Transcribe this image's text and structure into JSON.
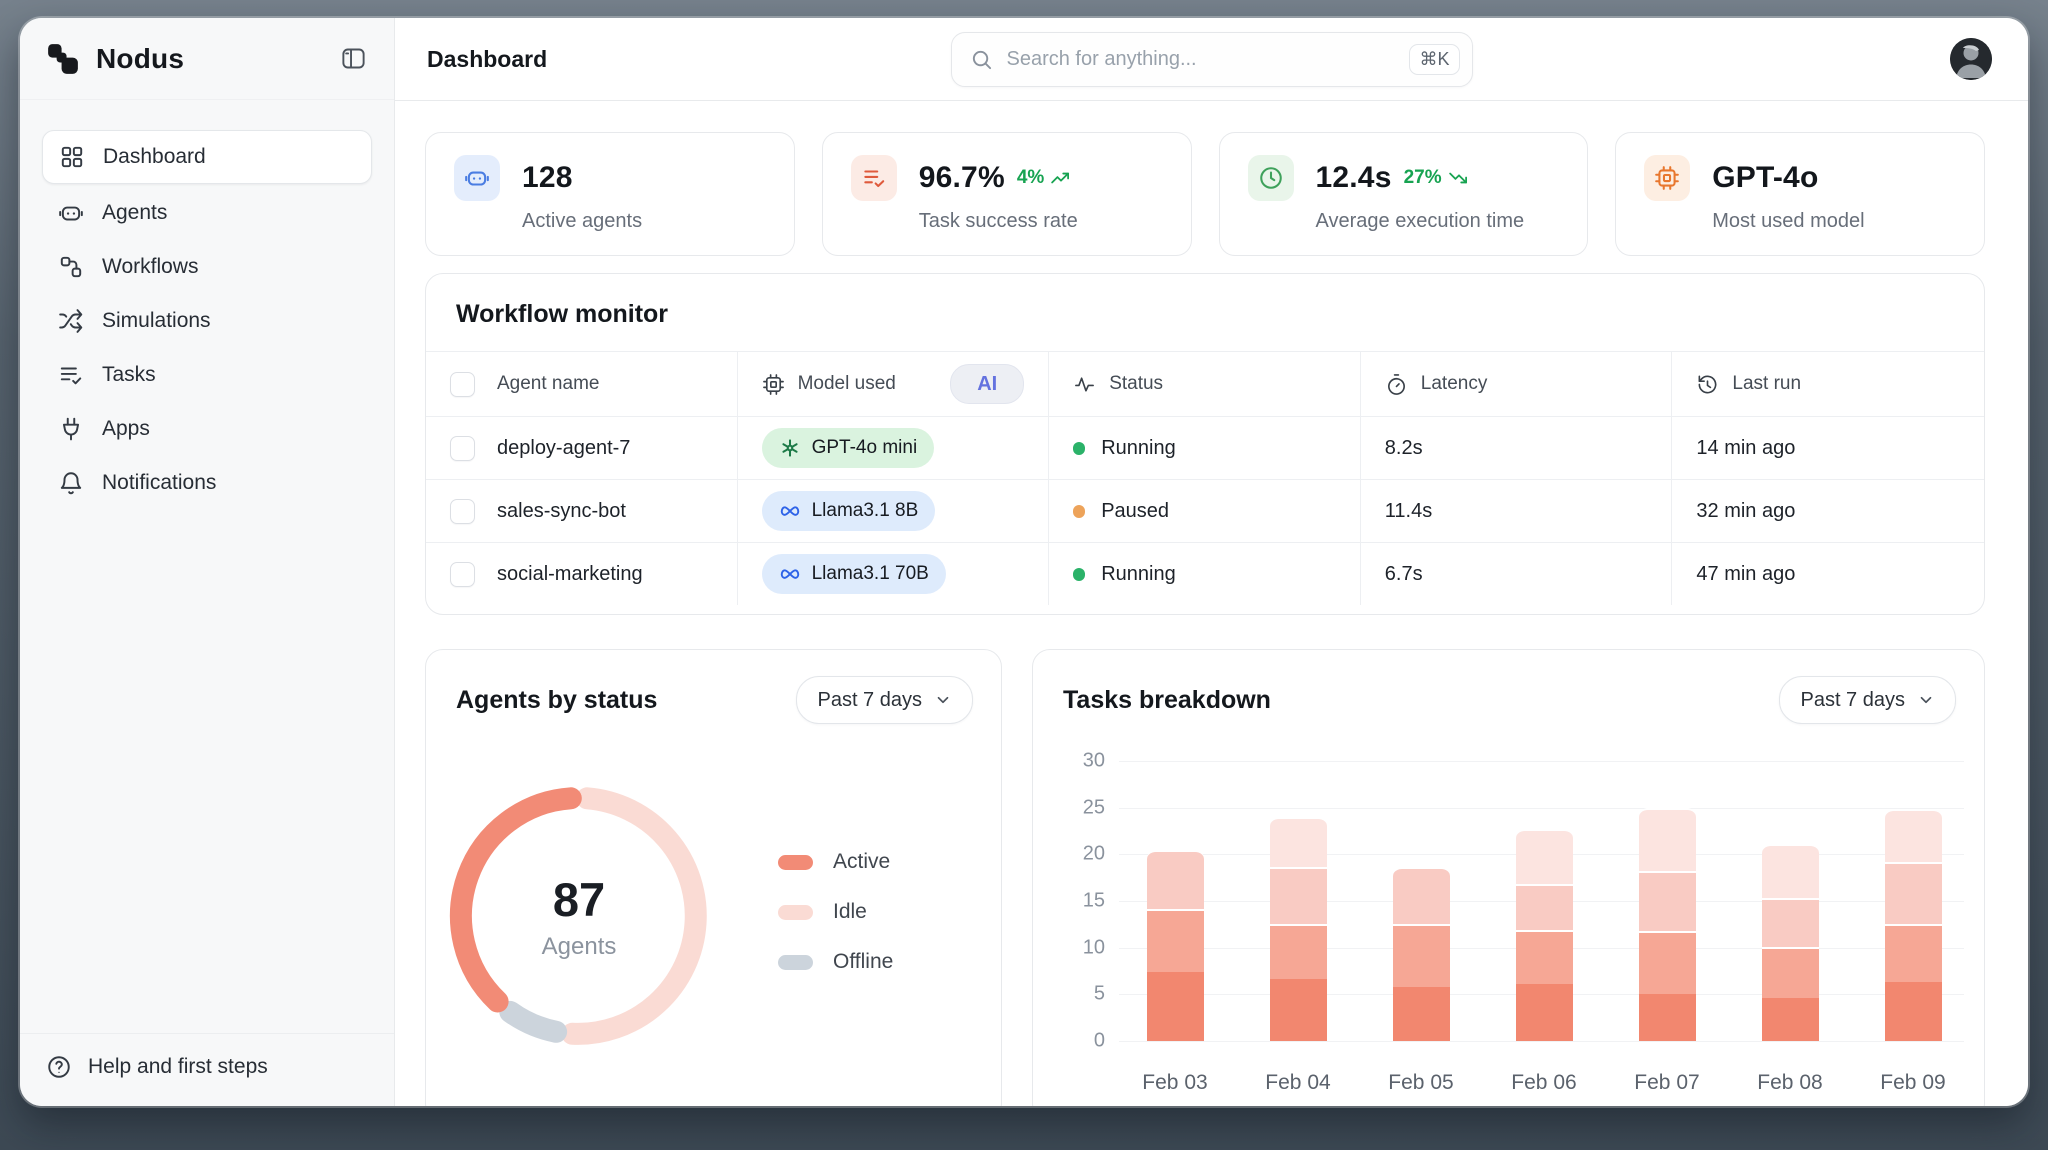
{
  "sidebar": {
    "brand": "Nodus",
    "items": [
      {
        "label": "Dashboard",
        "icon": "grid-icon",
        "active": true
      },
      {
        "label": "Agents",
        "icon": "bot-icon",
        "active": false
      },
      {
        "label": "Workflows",
        "icon": "workflow-icon",
        "active": false
      },
      {
        "label": "Simulations",
        "icon": "shuffle-icon",
        "active": false
      },
      {
        "label": "Tasks",
        "icon": "list-check-icon",
        "active": false
      },
      {
        "label": "Apps",
        "icon": "plug-icon",
        "active": false
      },
      {
        "label": "Notifications",
        "icon": "bell-icon",
        "active": false
      }
    ],
    "footer": {
      "label": "Help and first steps",
      "icon": "help-circle-icon"
    }
  },
  "topbar": {
    "title": "Dashboard",
    "search_placeholder": "Search for anything...",
    "shortcut": "⌘K"
  },
  "stats": [
    {
      "value": "128",
      "label": "Active agents",
      "icon": "bot-icon",
      "icon_color": "#4a7de2",
      "icon_bg": "#e4edfc",
      "trend": "",
      "trend_dir": ""
    },
    {
      "value": "96.7%",
      "label": "Task success rate",
      "icon": "clipboard-check-icon",
      "icon_color": "#df5a3c",
      "icon_bg": "#fcebe5",
      "trend": "4%",
      "trend_dir": "up"
    },
    {
      "value": "12.4s",
      "label": "Average execution time",
      "icon": "clock-icon",
      "icon_color": "#3ea15b",
      "icon_bg": "#e9f5ea",
      "trend": "27%",
      "trend_dir": "down"
    },
    {
      "value": "GPT-4o",
      "label": "Most used model",
      "icon": "cpu-icon",
      "icon_color": "#e8772e",
      "icon_bg": "#fdeee2",
      "trend": "",
      "trend_dir": ""
    }
  ],
  "monitor": {
    "title": "Workflow monitor",
    "columns": [
      {
        "label": "Agent name",
        "icon": "checkbox"
      },
      {
        "label": "Model used",
        "icon": "cpu-icon",
        "badge": "AI"
      },
      {
        "label": "Status",
        "icon": "activity-icon"
      },
      {
        "label": "Latency",
        "icon": "stopwatch-icon"
      },
      {
        "label": "Last run",
        "icon": "history-icon"
      }
    ],
    "rows": [
      {
        "agent": "deploy-agent-7",
        "model": "GPT-4o mini",
        "model_provider": "openai",
        "model_bg": "#daf3df",
        "model_icon_color": "#1c7a47",
        "status": "Running",
        "status_color": "#2bb269",
        "latency": "8.2s",
        "last_run": "14 min ago"
      },
      {
        "agent": "sales-sync-bot",
        "model": "Llama3.1 8B",
        "model_provider": "meta",
        "model_bg": "#deebfc",
        "model_icon_color": "#2e63e8",
        "status": "Paused",
        "status_color": "#eda35a",
        "latency": "11.4s",
        "last_run": "32 min ago"
      },
      {
        "agent": "social-marketing",
        "model": "Llama3.1 70B",
        "model_provider": "meta",
        "model_bg": "#deebfc",
        "model_icon_color": "#2e63e8",
        "status": "Running",
        "status_color": "#2bb269",
        "latency": "6.7s",
        "last_run": "47 min ago"
      }
    ]
  },
  "agents_by_status": {
    "title": "Agents by status",
    "range": "Past 7 days",
    "center_value": "87",
    "center_label": "Agents"
  },
  "tasks_breakdown": {
    "title": "Tasks breakdown",
    "range": "Past 7 days"
  },
  "chart_data": [
    {
      "type": "pie",
      "variant": "donut",
      "title": "Agents by status",
      "total": 87,
      "total_label": "87 Agents",
      "slices": [
        {
          "label": "Active",
          "percent": 39,
          "color": "#f28b76"
        },
        {
          "label": "Idle",
          "percent": 52,
          "color": "#fadbd4"
        },
        {
          "label": "Offline",
          "percent": 9,
          "color": "#ccd4dc"
        }
      ],
      "draw_order_clockwise_from_top": [
        "Idle",
        "Offline",
        "Active"
      ],
      "legend_position": "right",
      "gap_degrees": 8
    },
    {
      "type": "bar",
      "stacked": true,
      "title": "Tasks breakdown",
      "categories": [
        "Feb 03",
        "Feb 04",
        "Feb 05",
        "Feb 06",
        "Feb 07",
        "Feb 08",
        "Feb 09"
      ],
      "series": [
        {
          "name": "segment-1",
          "color": "#f2876f",
          "values": [
            7.5,
            6.8,
            5.9,
            6.3,
            5.2,
            4.8,
            6.5
          ]
        },
        {
          "name": "segment-2",
          "color": "#f6a795",
          "values": [
            6.7,
            5.9,
            6.7,
            5.7,
            6.7,
            5.4,
            6.1
          ]
        },
        {
          "name": "segment-3",
          "color": "#f9cbc3",
          "values": [
            6.3,
            6.0,
            6.1,
            4.9,
            6.4,
            5.2,
            6.7
          ]
        },
        {
          "name": "segment-4",
          "color": "#fce4e0",
          "values": [
            0,
            5.3,
            0,
            5.8,
            6.7,
            5.7,
            5.6
          ]
        }
      ],
      "totals": [
        20.5,
        24.0,
        18.7,
        22.7,
        25.0,
        21.1,
        24.9
      ],
      "xlabel": "",
      "ylabel": "",
      "ylim": [
        0,
        30
      ],
      "yticks": [
        0,
        5,
        10,
        15,
        20,
        25,
        30
      ],
      "grid": true,
      "legend": false
    }
  ]
}
